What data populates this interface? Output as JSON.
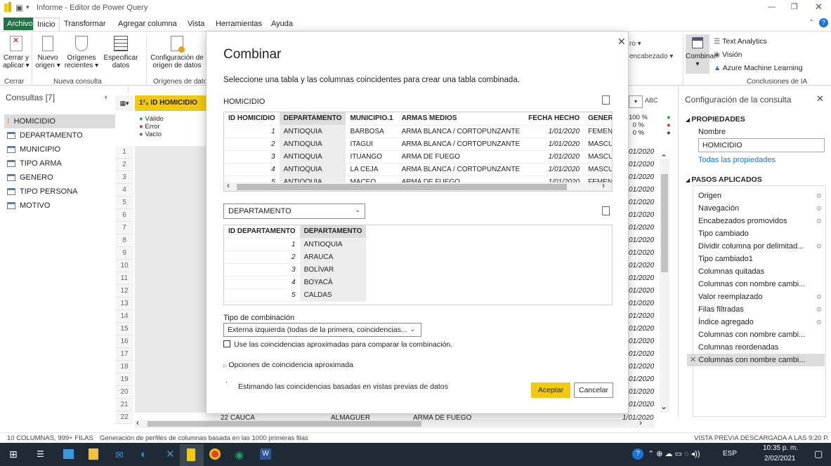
{
  "window": {
    "title": "Informe - Editor de Power Query"
  },
  "ribbon_tabs": [
    "Archivo",
    "Inicio",
    "Transformar",
    "Agregar columna",
    "Vista",
    "Herramientas",
    "Ayuda"
  ],
  "ribbon": {
    "cerrar_aplicar": "Cerrar y aplicar ▾",
    "nuevo_origen": "Nuevo origen ▾",
    "origenes_recientes": "Orígenes recientes ▾",
    "especificar_datos": "Especificar datos",
    "config_origen": "Configuración de origen de datos",
    "group_cerrar": "Cerrar",
    "group_nueva": "Nueva consulta",
    "group_origenes": "Orígenes de datos",
    "ro": "ro ▾",
    "encabezado": "encabezado ▾",
    "combinar": "Combinar",
    "text_analytics": "Text Analytics",
    "vision": "Visión",
    "azure_ml": "Azure Machine Learning",
    "group_ia": "Conclusiones de IA"
  },
  "queries": {
    "header": "Consultas [7]",
    "items": [
      "HOMICIDIO",
      "DEPARTAMENTO",
      "MUNICIPIO",
      "TIPO ARMA",
      "GENERO",
      "TIPO PERSONA",
      "MOTIVO"
    ]
  },
  "grid": {
    "col_header": "ID HOMICIDIO",
    "type_label": "1²₃",
    "quality": [
      "Válido",
      "Error",
      "Vacío"
    ],
    "rows": [
      "1",
      "2",
      "3",
      "4",
      "5",
      "6",
      "7",
      "8",
      "9",
      "10",
      "11",
      "12",
      "13",
      "14",
      "15",
      "16",
      "17",
      "18",
      "19",
      "20",
      "21",
      "22"
    ],
    "right_pct": [
      "100 %",
      "0 %",
      "0 %"
    ],
    "right_dates": [
      "01/2020",
      "01/2020",
      "01/2020",
      "01/2020",
      "01/2020",
      "01/2020",
      "01/2020",
      "01/2020",
      "01/2020",
      "01/2020",
      "01/2020",
      "01/2020",
      "01/2020",
      "01/2020",
      "01/2020",
      "01/2020",
      "01/2020",
      "01/2020",
      "01/2020",
      "01/2020",
      "01/2020"
    ],
    "last_row": {
      "id": "22",
      "dep": "CAUCA",
      "mun": "ALMAGUER",
      "arma": "ARMA DE FUEGO",
      "fecha": "1/01/2020"
    },
    "col_abc": "ABC"
  },
  "settings": {
    "title": "Configuración de la consulta",
    "propiedades": "PROPIEDADES",
    "nombre_label": "Nombre",
    "nombre_value": "HOMICIDIO",
    "todas": "Todas las propiedades",
    "pasos_title": "PASOS APLICADOS",
    "steps": [
      "Origen",
      "Navegación",
      "Encabezados promovidos",
      "Tipo cambiado",
      "Dividir columna por delimitad...",
      "Tipo cambiado1",
      "Columnas quitadas",
      "Columnas con nombre cambi...",
      "Valor reemplazado",
      "Filas filtradas",
      "Índice agregado",
      "Columnas con nombre cambi...",
      "Columnas reordenadas",
      "Columnas con nombre cambi..."
    ]
  },
  "dialog": {
    "title": "Combinar",
    "subtitle": "Seleccione una tabla y las columnas coincidentes para crear una tabla combinada.",
    "table1_name": "HOMICIDIO",
    "t1_headers": [
      "ID HOMICIDIO",
      "DEPARTAMENTO",
      "MUNICIPIO.1",
      "ARMAS MEDIOS",
      "FECHA HECHO",
      "GENERO"
    ],
    "t1_rows": [
      [
        "1",
        "ANTIOQUIA",
        "BARBOSA",
        "ARMA BLANCA / CORTOPUNZANTE",
        "1/01/2020",
        "FEMENINO"
      ],
      [
        "2",
        "ANTIOQUIA",
        "ITAGUI",
        "ARMA BLANCA / CORTOPUNZANTE",
        "1/01/2020",
        "MASCULINO"
      ],
      [
        "3",
        "ANTIOQUIA",
        "ITUANGO",
        "ARMA DE FUEGO",
        "1/01/2020",
        "MASCULINO"
      ],
      [
        "4",
        "ANTIOQUIA",
        "LA CEJA",
        "ARMA BLANCA / CORTOPUNZANTE",
        "1/01/2020",
        "MASCULINO"
      ],
      [
        "5",
        "ANTIOQUIA",
        "MACEO",
        "ARMA DE FUEGO",
        "1/01/2020",
        "FEMENINO"
      ]
    ],
    "table2_select": "DEPARTAMENTO",
    "t2_headers": [
      "ID DEPARTAMENTO",
      "DEPARTAMENTO"
    ],
    "t2_rows": [
      [
        "1",
        "ANTIOQUIA"
      ],
      [
        "2",
        "ARAUCA"
      ],
      [
        "3",
        "BOLÍVAR"
      ],
      [
        "4",
        "BOYACÁ"
      ],
      [
        "5",
        "CALDAS"
      ]
    ],
    "join_label": "Tipo de combinación",
    "join_value": "Externa izquierda (todas de la primera, coincidencias...",
    "fuzzy_check": "Use las coincidencias aproximadas para comparar la combinación.",
    "fuzzy_options": "Opciones de coincidencia aproximada",
    "estimating": "Estimando las coincidencias basadas en vistas previas de datos",
    "accept": "Aceptar",
    "cancel": "Cancelar"
  },
  "status": {
    "left": "10 COLUMNAS, 999+ FILAS",
    "middle": "Generación de perfiles de columnas basada en las 1000 primeras filas",
    "right": "VISTA PREVIA DESCARGADA A LAS 9:20 P. M."
  },
  "taskbar": {
    "time": "10:35 p. m.",
    "date": "2/02/2021",
    "lang": "ESP"
  },
  "colors": {
    "accent": "#f2c811",
    "ribbon_file": "#217346",
    "taskbar": "#1f2a36"
  }
}
